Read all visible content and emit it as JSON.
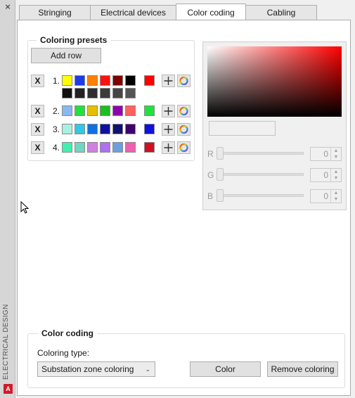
{
  "sidebar": {
    "close_glyph": "×",
    "title": "ELECTRICAL DESIGN",
    "logo_text": "A"
  },
  "tabs": [
    {
      "label": "Stringing",
      "active": false
    },
    {
      "label": "Electrical devices",
      "active": false
    },
    {
      "label": "Color coding",
      "active": true
    },
    {
      "label": "Cabling",
      "active": false
    }
  ],
  "presets": {
    "title": "Coloring presets",
    "add_row_label": "Add row",
    "remove_glyph": "X",
    "rows": [
      {
        "num": "1.",
        "colors": [
          "#ffff00",
          "#1e3ce6",
          "#ff8000",
          "#ff1010",
          "#800000",
          "#000000",
          "#111111",
          "#222222",
          "#2e2e2e",
          "#3a3a3a",
          "#464646",
          "#555555"
        ],
        "selected": "#ff0000"
      },
      {
        "num": "2.",
        "colors": [
          "#8ab8f0",
          "#22e040",
          "#e6c000",
          "#1ebe1e",
          "#9000b0",
          "#ff6060"
        ],
        "selected": "#22e040"
      },
      {
        "num": "3.",
        "colors": [
          "#a8f0e0",
          "#30c8e6",
          "#1070e0",
          "#1010a0",
          "#101070",
          "#400070"
        ],
        "selected": "#1010e0"
      },
      {
        "num": "4.",
        "colors": [
          "#40f0b0",
          "#70d6c0",
          "#d080e0",
          "#b070f0",
          "#6aa0e0",
          "#f060b0"
        ],
        "selected": "#d01020"
      }
    ]
  },
  "picker": {
    "channels": [
      {
        "label": "R",
        "value": "0"
      },
      {
        "label": "G",
        "value": "0"
      },
      {
        "label": "B",
        "value": "0"
      }
    ]
  },
  "color_coding": {
    "title": "Color coding",
    "type_label": "Coloring type:",
    "type_value": "Substation zone coloring",
    "color_button": "Color",
    "remove_button": "Remove coloring"
  },
  "icons": {
    "plus": "plus-icon",
    "palette": "color-wheel-icon",
    "close": "close-icon",
    "chevron": "chevron-down-icon"
  }
}
